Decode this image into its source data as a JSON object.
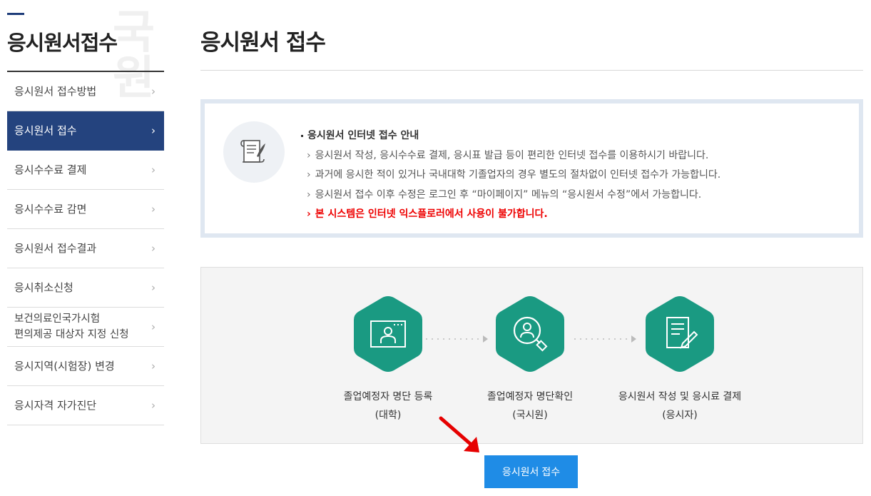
{
  "sidebar": {
    "title": "응시원서접수",
    "watermark": "국원",
    "items": [
      {
        "label": "응시원서 접수방법",
        "active": false
      },
      {
        "label": "응시원서 접수",
        "active": true
      },
      {
        "label": "응시수수료 결제",
        "active": false
      },
      {
        "label": "응시수수료 감면",
        "active": false
      },
      {
        "label": "응시원서 접수결과",
        "active": false
      },
      {
        "label": "응시취소신청",
        "active": false
      },
      {
        "label": "보건의료인국가시험\n편의제공 대상자 지정 신청",
        "active": false
      },
      {
        "label": "응시지역(시험장) 변경",
        "active": false
      },
      {
        "label": "응시자격 자가진단",
        "active": false
      }
    ]
  },
  "main": {
    "title": "응시원서 접수",
    "notice": {
      "heading": "응시원서 인터넷 접수 안내",
      "lines": [
        "응시원서 작성, 응시수수료 결제, 응시표 발급 등이 편리한 인터넷 접수를 이용하시기 바랍니다.",
        "과거에 응시한 적이 있거나 국내대학 기졸업자의 경우 별도의 절차없이 인터넷 접수가 가능합니다.",
        "응시원서 접수 이후 수정은 로그인 후 “마이페이지” 메뉴의 “응시원서 수정”에서 가능합니다."
      ],
      "warning": "본 시스템은 인터넷 익스플로러에서 사용이 불가합니다."
    },
    "steps": [
      {
        "line1": "졸업예정자 명단 등록",
        "line2": "(대학)",
        "icon": "monitor-person-icon"
      },
      {
        "line1": "졸업예정자 명단확인",
        "line2": "(국시원)",
        "icon": "magnifier-person-icon"
      },
      {
        "line1": "응시원서 작성 및 응시료 결제",
        "line2": "(응시자)",
        "icon": "document-pen-icon"
      }
    ],
    "apply_button": "응시원서 접수"
  },
  "colors": {
    "navy": "#24437e",
    "teal": "#1a9a82",
    "button_blue": "#1f8ce6",
    "warning_red": "#ee0000"
  }
}
